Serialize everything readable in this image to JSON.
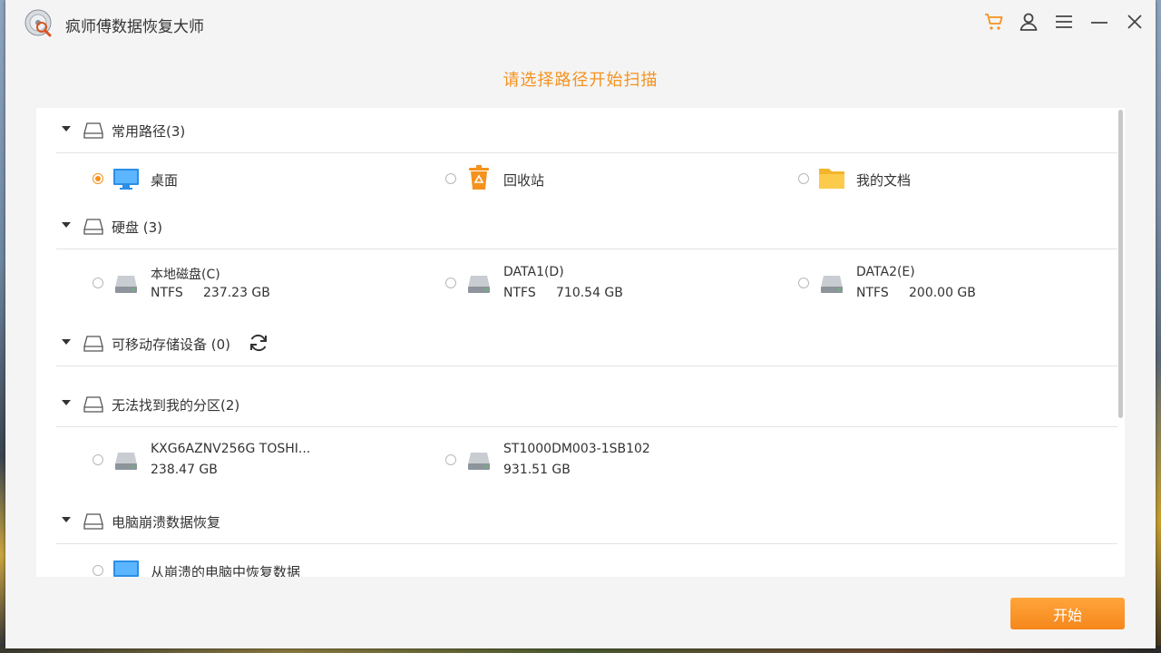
{
  "window": {
    "title": "疯师傅数据恢复大师"
  },
  "titlebar_icons": [
    "cart-icon",
    "user-icon",
    "menu-icon",
    "minimize-icon",
    "close-icon"
  ],
  "subtitle": "请选择路径开始扫描",
  "sections": {
    "common": {
      "title": "常用路径(3)",
      "items": [
        {
          "label": "桌面",
          "icon": "desktop-icon",
          "selected": true
        },
        {
          "label": "回收站",
          "icon": "recycle-bin-icon",
          "selected": false
        },
        {
          "label": "我的文档",
          "icon": "folder-icon",
          "selected": false
        }
      ]
    },
    "disks": {
      "title": "硬盘 (3)",
      "items": [
        {
          "name": "本地磁盘(C)",
          "fs": "NTFS",
          "size": "237.23 GB"
        },
        {
          "name": "DATA1(D)",
          "fs": "NTFS",
          "size": "710.54 GB"
        },
        {
          "name": "DATA2(E)",
          "fs": "NTFS",
          "size": "200.00 GB"
        }
      ]
    },
    "removable": {
      "title": "可移动存储设备 (0)"
    },
    "lost": {
      "title": "无法找到我的分区(2)",
      "items": [
        {
          "name": "KXG6AZNV256G TOSHI...",
          "size": "238.47 GB"
        },
        {
          "name": "ST1000DM003-1SB102",
          "size": "931.51 GB"
        }
      ]
    },
    "crash": {
      "title": "电脑崩溃数据恢复",
      "items": [
        {
          "label": "从崩溃的电脑中恢复数据",
          "icon": "monitor-icon"
        }
      ]
    }
  },
  "start_button": "开始",
  "colors": {
    "accent": "#f5921e",
    "text": "#333333",
    "panel": "#ffffff",
    "window": "#f4f4f4"
  }
}
